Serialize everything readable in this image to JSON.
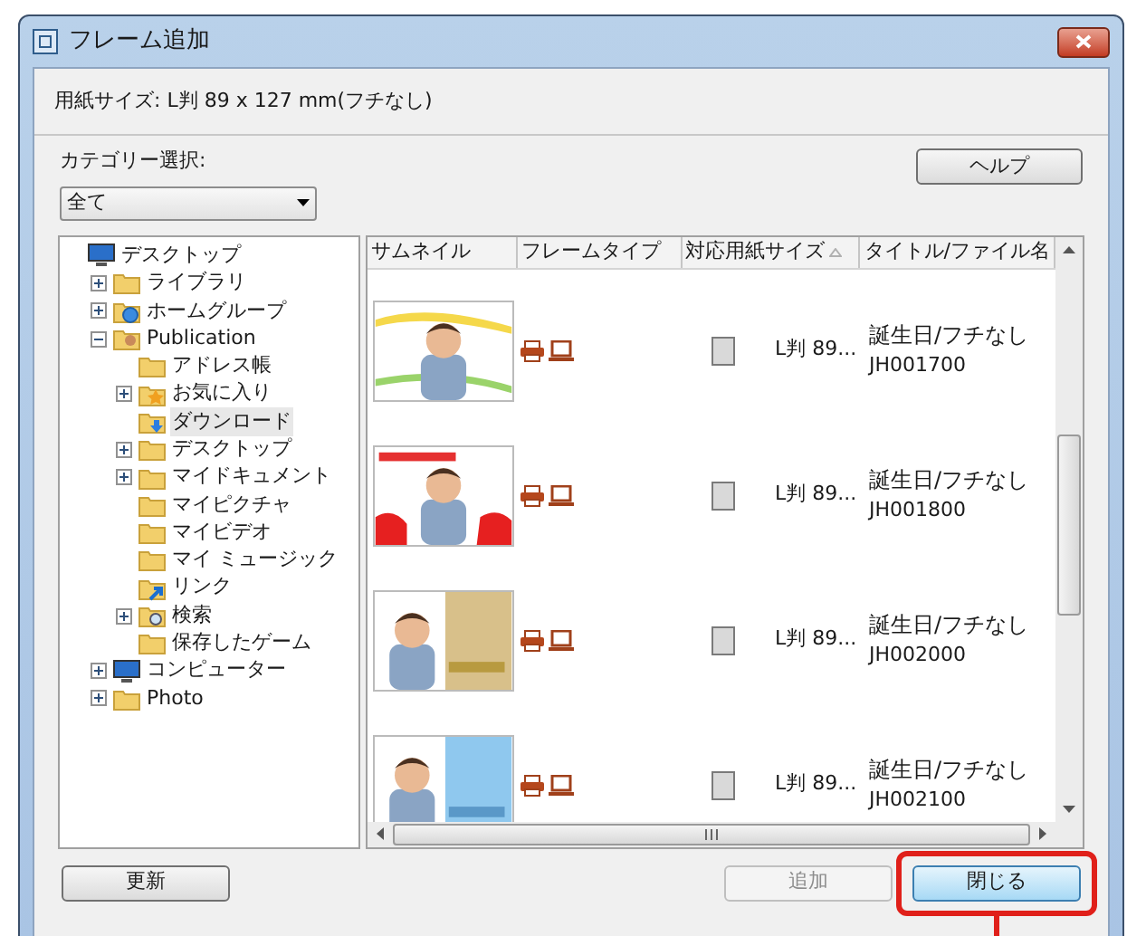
{
  "window": {
    "title": "フレーム追加"
  },
  "paper_size": "用紙サイズ: L判 89 x 127 mm(フチなし)",
  "category": {
    "label": "カテゴリー選択:",
    "value": "全て"
  },
  "help_button": "ヘルプ",
  "tree": [
    {
      "label": "デスクトップ",
      "kind": "monitor",
      "selected": false,
      "children": [
        {
          "label": "ライブラリ",
          "kind": "folder",
          "expanded": false,
          "selected": false
        },
        {
          "label": "ホームグループ",
          "kind": "globe",
          "expanded": false,
          "selected": false
        },
        {
          "label": "Publication",
          "kind": "user",
          "expanded": true,
          "selected": false,
          "children": [
            {
              "label": "アドレス帳",
              "kind": "folder",
              "selected": false
            },
            {
              "label": "お気に入り",
              "kind": "star",
              "expanded": false,
              "selected": false
            },
            {
              "label": "ダウンロード",
              "kind": "download",
              "selected": true
            },
            {
              "label": "デスクトップ",
              "kind": "folder",
              "expanded": false,
              "selected": false
            },
            {
              "label": "マイドキュメント",
              "kind": "folder",
              "expanded": false,
              "selected": false
            },
            {
              "label": "マイピクチャ",
              "kind": "folder",
              "selected": false
            },
            {
              "label": "マイビデオ",
              "kind": "folder",
              "selected": false
            },
            {
              "label": "マイ ミュージック",
              "kind": "folder",
              "selected": false
            },
            {
              "label": "リンク",
              "kind": "link",
              "selected": false
            },
            {
              "label": "検索",
              "kind": "search",
              "expanded": false,
              "selected": false
            },
            {
              "label": "保存したゲーム",
              "kind": "folder",
              "selected": false
            }
          ]
        },
        {
          "label": "コンピューター",
          "kind": "monitor",
          "expanded": false,
          "selected": false
        },
        {
          "label": "Photo",
          "kind": "folder",
          "expanded": false,
          "selected": false
        }
      ]
    }
  ],
  "table": {
    "columns": [
      {
        "label": "サムネイル"
      },
      {
        "label": "フレームタイプ"
      },
      {
        "label": "対応用紙サイズ",
        "sorted": true
      },
      {
        "label": "タイトル/ファイル名"
      }
    ],
    "rows": [
      {
        "paper": "L判 89...",
        "title": "誕生日/フチなし",
        "file": "JH001700"
      },
      {
        "paper": "L判 89...",
        "title": "誕生日/フチなし",
        "file": "JH001800"
      },
      {
        "paper": "L判 89...",
        "title": "誕生日/フチなし",
        "file": "JH002000"
      },
      {
        "paper": "L判 89...",
        "title": "誕生日/フチなし",
        "file": "JH002100"
      }
    ]
  },
  "buttons": {
    "refresh": "更新",
    "add": {
      "label": "追加",
      "disabled": true
    },
    "close": {
      "label": "閉じる",
      "highlighted": true
    }
  }
}
